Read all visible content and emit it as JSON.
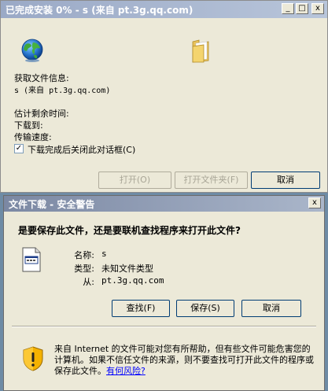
{
  "progress_window": {
    "title": "已完成安装 0% - s (来自 pt.3g.qq.com)",
    "minimize_glyph": "_",
    "maximize_glyph": "□",
    "close_glyph": "x",
    "get_info_label": "获取文件信息:",
    "file_source": "s (来自 pt.3g.qq.com)",
    "time_left_label": "估计剩余时间:",
    "download_to_label": "下载到:",
    "transfer_rate_label": "传输速度:",
    "checkbox_checked": true,
    "checkbox_label": "下载完成后关闭此对话框(C)",
    "buttons": {
      "open": "打开(O)",
      "open_folder": "打开文件夹(F)",
      "cancel": "取消"
    }
  },
  "security_dialog": {
    "title": "文件下载 - 安全警告",
    "close_glyph": "x",
    "question": "是要保存此文件，还是要联机查找程序来打开此文件?",
    "fields": {
      "name_label": "名称:",
      "name_value": "s",
      "type_label": "类型:",
      "type_value": "未知文件类型",
      "from_label": "从:",
      "from_value": "pt.3g.qq.com"
    },
    "buttons": {
      "find": "查找(F)",
      "save": "保存(S)",
      "cancel": "取消"
    },
    "warning_text": "来自 Internet 的文件可能对您有所帮助，但有些文件可能危害您的计算机。如果不信任文件的来源，则不要查找可打开此文件的程序或保存此文件。",
    "warning_link": "有何风险?"
  }
}
